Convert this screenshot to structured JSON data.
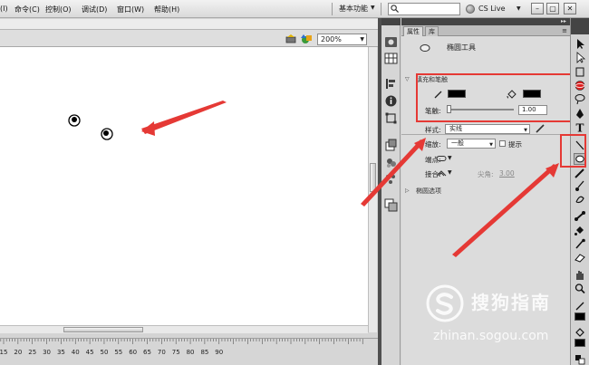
{
  "menubar": {
    "items": [
      "(I)",
      "命令(C)",
      "控制(O)",
      "调试(D)",
      "窗口(W)",
      "帮助(H)"
    ],
    "workspace_label": "基本功能",
    "search_placeholder": "",
    "cslive_label": "CS Live"
  },
  "stage": {
    "zoom": "200%"
  },
  "ruler": {
    "ticks": [
      "15",
      "20",
      "25",
      "30",
      "35",
      "40",
      "45",
      "50",
      "55",
      "60",
      "65",
      "70",
      "75",
      "80",
      "85",
      "90"
    ]
  },
  "properties_panel": {
    "tabs": [
      "属性",
      "库"
    ],
    "tool_name": "椭圆工具",
    "section_fill_stroke": "填充和笔触",
    "stroke_label": "笔触:",
    "stroke_value": "1.00",
    "stroke_color": "#000000",
    "fill_color": "#000000",
    "style_label": "样式:",
    "style_value": "实线",
    "scale_label": "缩放:",
    "scale_value": "一般",
    "hint_label": "提示",
    "cap_label": "端点:",
    "join_label": "接合:",
    "miter_label": "尖角:",
    "miter_value": "3.00",
    "section_oval_options": "椭圆选项"
  },
  "watermark": {
    "title": "搜狗指南",
    "url": "zhinan.sogou.com"
  },
  "annotation_color": "#e53935"
}
